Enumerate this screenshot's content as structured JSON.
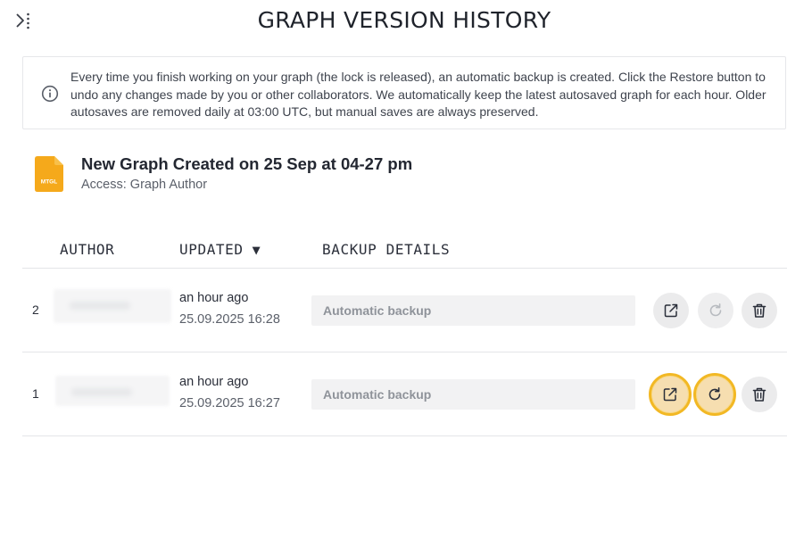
{
  "header": {
    "title": "GRAPH VERSION HISTORY"
  },
  "info": {
    "text": "Every time you finish working on your graph (the lock is released), an automatic backup is created. Click the Restore button to undo any changes made by you or other collaborators. We automatically keep the latest autosaved graph for each hour. Older autosaves are removed daily at 03:00 UTC, but manual saves are always preserved."
  },
  "graph": {
    "icon_label": "MTGL",
    "title": "New Graph Created on 25 Sep at 04-27 pm",
    "access": "Access: Graph Author"
  },
  "table": {
    "columns": {
      "author": "AUTHOR",
      "updated": "UPDATED",
      "sort_indicator": "▼",
      "details": "BACKUP DETAILS"
    },
    "rows": [
      {
        "index": "2",
        "relative_time": "an hour ago",
        "timestamp": "25.09.2025 16:28",
        "details": "Automatic backup",
        "restore_enabled": false,
        "highlighted": false
      },
      {
        "index": "1",
        "relative_time": "an hour ago",
        "timestamp": "25.09.2025 16:27",
        "details": "Automatic backup",
        "restore_enabled": true,
        "highlighted": true
      }
    ]
  },
  "colors": {
    "accent_orange": "#f2b824",
    "graph_icon": "#f5a91b",
    "button_bg": "#ebebec"
  },
  "icons": {
    "collapse": "sidebar-expand-icon",
    "info": "info-icon",
    "graph_file": "graph-file-icon",
    "open": "external-link-icon",
    "restore": "refresh-icon",
    "delete": "trash-icon"
  }
}
